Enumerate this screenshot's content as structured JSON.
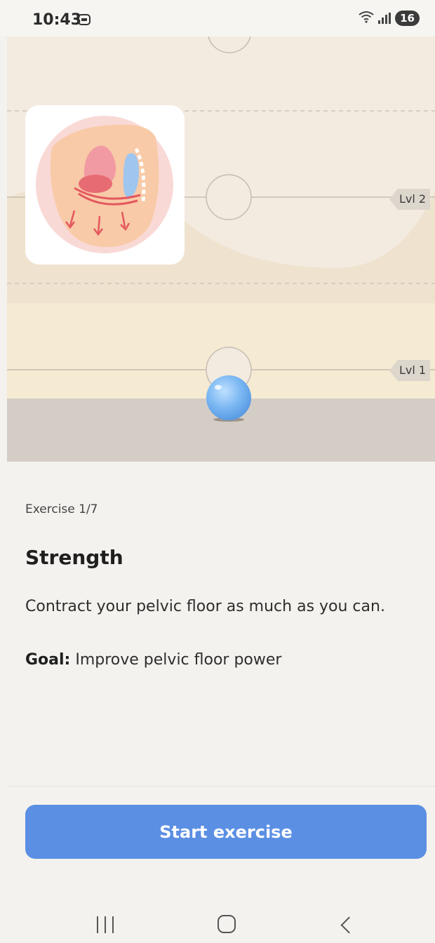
{
  "status_bar": {
    "time": "10:43",
    "battery": "16",
    "icons": [
      "screenshot-icon",
      "wifi-icon",
      "signal-icon",
      "battery-badge"
    ]
  },
  "game": {
    "levels": [
      {
        "label": "Lvl 2"
      },
      {
        "label": "Lvl 1"
      }
    ],
    "illustration": "pelvic-floor-illustration",
    "indicator": "blue-ball"
  },
  "exercise": {
    "counter": "Exercise 1/7",
    "title": "Strength",
    "instruction": "Contract your pelvic floor as much as you can.",
    "goal_label": "Goal:",
    "goal_text": " Improve pelvic floor power"
  },
  "actions": {
    "start_label": "Start exercise"
  },
  "colors": {
    "accent": "#5b8fe3",
    "background": "#f4f2ee",
    "game_background": "#f3ebe0"
  }
}
